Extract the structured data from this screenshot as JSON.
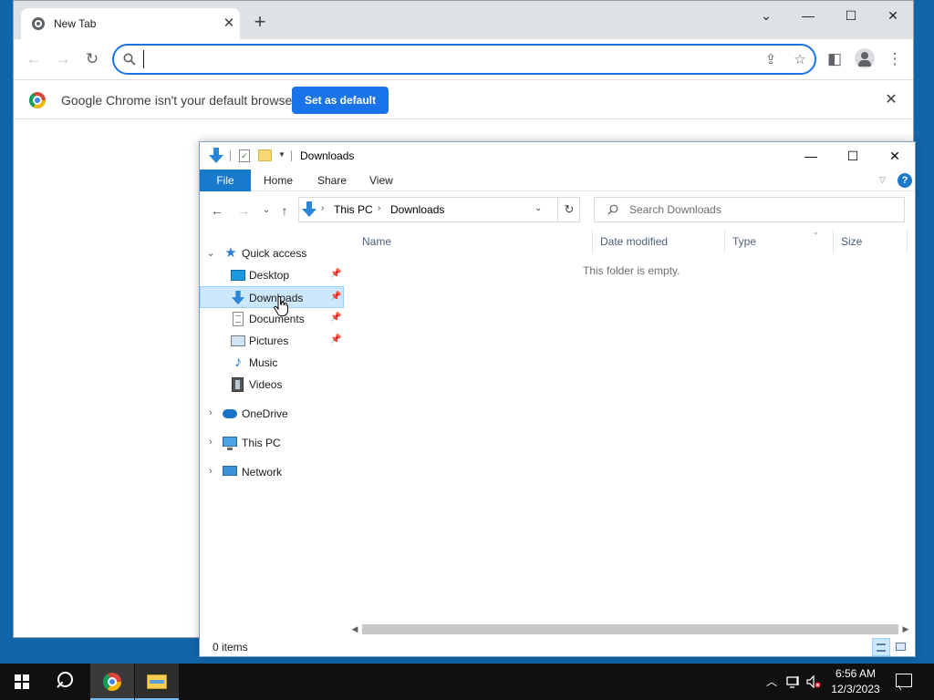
{
  "chrome": {
    "tab_title": "New Tab",
    "tab_close": "✕",
    "new_tab": "+",
    "window_controls": {
      "dropdown": "⌄",
      "minimize": "—",
      "maximize": "☐",
      "close": "✕"
    },
    "toolbar": {
      "back": "←",
      "forward": "→",
      "reload": "↻",
      "share": "⇪",
      "bookmark": "☆",
      "side_panel": "◧",
      "menu": "⋮"
    },
    "omnibox": {
      "value": "",
      "placeholder": ""
    },
    "infobar": {
      "message": "Google Chrome isn't your default browser",
      "button": "Set as default",
      "close": "✕"
    }
  },
  "explorer": {
    "title": "Downloads",
    "window_controls": {
      "minimize": "—",
      "maximize": "☐",
      "close": "✕"
    },
    "ribbon": {
      "file": "File",
      "tabs": [
        "Home",
        "Share",
        "View"
      ],
      "help": "?"
    },
    "nav": {
      "back": "←",
      "forward": "→",
      "recent": "⌄",
      "up": "↑"
    },
    "address": {
      "segments": [
        "This PC",
        "Downloads"
      ],
      "separator": "›",
      "dropdown": "⌄",
      "refresh": "↻"
    },
    "search": {
      "placeholder": "Search Downloads"
    },
    "navpane": {
      "quick_access": "Quick access",
      "pinned": [
        {
          "label": "Desktop",
          "pinned": true
        },
        {
          "label": "Downloads",
          "pinned": true,
          "selected": true
        },
        {
          "label": "Documents",
          "pinned": true
        },
        {
          "label": "Pictures",
          "pinned": true
        },
        {
          "label": "Music",
          "pinned": false
        },
        {
          "label": "Videos",
          "pinned": false
        }
      ],
      "onedrive": "OneDrive",
      "this_pc": "This PC",
      "network": "Network",
      "expand": "›",
      "collapse": "⌄",
      "pin": "📌"
    },
    "columns": [
      "Name",
      "Date modified",
      "Type",
      "Size"
    ],
    "empty_message": "This folder is empty.",
    "status": "0 items",
    "colors": {
      "file_tab": "#1979ca",
      "selected": "#cce8ff"
    }
  },
  "taskbar": {
    "time": "6:56 AM",
    "date": "12/3/2023",
    "tray_chevron": "︿"
  }
}
